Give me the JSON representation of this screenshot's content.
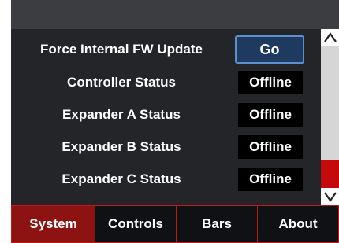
{
  "settings": {
    "rows": [
      {
        "label": "Force Internal FW Update",
        "button_label": "Go"
      },
      {
        "label": "Controller Status",
        "value": "Offline"
      },
      {
        "label": "Expander A Status",
        "value": "Offline"
      },
      {
        "label": "Expander B Status",
        "value": "Offline"
      },
      {
        "label": "Expander C Status",
        "value": "Offline"
      }
    ]
  },
  "scrollbar": {
    "position": "end",
    "up_icon": "chevron-up-icon",
    "down_icon": "chevron-down-icon"
  },
  "tabs": [
    {
      "label": "System",
      "active": true
    },
    {
      "label": "Controls",
      "active": false
    },
    {
      "label": "Bars",
      "active": false
    },
    {
      "label": "About",
      "active": false
    }
  ],
  "colors": {
    "background": "#232528",
    "top_bar": "#3b3d40",
    "active_tab": "#8d1212",
    "tab_border": "#c01818",
    "button_border": "#5b8fd0",
    "scroll_thumb": "#c40a0a"
  }
}
